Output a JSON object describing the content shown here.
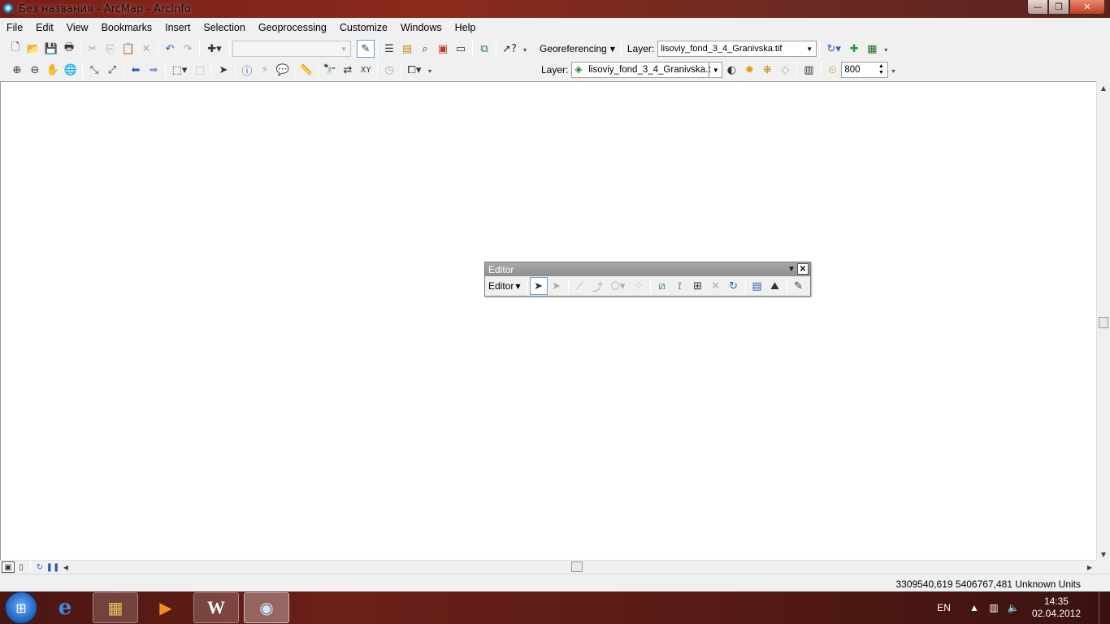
{
  "window": {
    "title": "Без названия - ArcMap - ArcInfo",
    "app_icon": "arcmap-globe-icon",
    "buttons": {
      "minimize": "—",
      "maximize": "❐",
      "close": "✕"
    }
  },
  "menubar": {
    "items": [
      "File",
      "Edit",
      "View",
      "Bookmarks",
      "Insert",
      "Selection",
      "Geoprocessing",
      "Customize",
      "Windows",
      "Help"
    ]
  },
  "standard_toolbar": {
    "scale_combo_value": "",
    "icons": [
      "new-icon",
      "open-icon",
      "save-icon",
      "print-icon",
      "cut-icon",
      "copy-icon",
      "paste-icon",
      "delete-icon",
      "undo-icon",
      "redo-icon",
      "add-data-icon",
      "editor-toolbar-icon",
      "toc-icon",
      "catalog-icon",
      "search-icon",
      "arctoolbox-icon",
      "python-icon",
      "model-builder-icon",
      "whats-this-icon"
    ]
  },
  "georeferencing_toolbar": {
    "menu_label": "Georeferencing",
    "layer_label": "Layer:",
    "layer_value": "lisoviy_fond_3_4_Granivska.tif"
  },
  "tools_toolbar": {
    "icons": [
      "zoom-in-icon",
      "zoom-out-icon",
      "pan-icon",
      "full-extent-icon",
      "fixed-zoom-in-icon",
      "fixed-zoom-out-icon",
      "back-icon",
      "forward-icon",
      "select-features-icon",
      "clear-selection-icon",
      "select-elements-icon",
      "identify-icon",
      "hyperlink-icon",
      "html-popup-icon",
      "measure-icon",
      "find-icon",
      "find-route-icon",
      "go-to-xy-icon",
      "time-slider-icon",
      "create-viewer-icon"
    ]
  },
  "effects_toolbar": {
    "layer_label": "Layer:",
    "layer_value": "lisoviy_fond_3_4_Granivska.t",
    "zoom_value": "800"
  },
  "editor": {
    "title": "Editor",
    "menu_label": "Editor"
  },
  "statusbar": {
    "coords": "3309540,619  5406767,481 Unknown Units"
  },
  "taskbar": {
    "items": [
      {
        "icon": "internet-explorer-icon",
        "glyph": "e"
      },
      {
        "icon": "file-explorer-icon",
        "glyph": "📁"
      },
      {
        "icon": "media-player-icon",
        "glyph": "▶"
      },
      {
        "icon": "word-icon",
        "glyph": "W"
      },
      {
        "icon": "arcmap-icon",
        "glyph": "🔍"
      }
    ],
    "language": "EN",
    "time": "14:35",
    "date": "02.04.2012"
  }
}
